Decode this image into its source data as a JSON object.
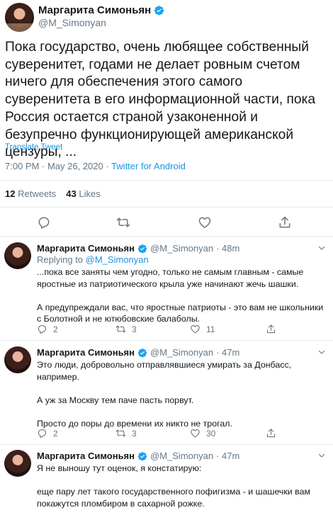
{
  "main": {
    "name": "Маргарита Симоньян",
    "handle": "@M_Simonyan",
    "text": "Пока государство, очень любящее собственный суверенитет, годами не делает ровным счетом ничего для обеспечения этого самого суверенитета в его информационной части, пока Россия остается страной узаконенной и безупречно функционирующей американской цензуры, ...",
    "translate_label": "Translate Tweet",
    "time": "7:00 PM · May 26, 2020 · ",
    "app": "Twitter for Android",
    "retweets_count": "12",
    "retweets_label": "Retweets",
    "likes_count": "43",
    "likes_label": "Likes"
  },
  "replies": [
    {
      "name": "Маргарита Симоньян",
      "handle": "@M_Simonyan",
      "time": "· 48m",
      "replying_label": "Replying to",
      "replying_to": "@M_Simonyan",
      "paragraphs": [
        "...пока все заняты чем угодно, только не самым главным - самые яростные из патриотического крыла уже начинают жечь шашки.",
        "А предупреждали вас, что яростные патриоты - это вам не школьники с  Болотной и не ютюбовские балаболы."
      ],
      "reply_count": "2",
      "retweet_count": "3",
      "like_count": "11"
    },
    {
      "name": "Маргарита Симоньян",
      "handle": "@M_Simonyan",
      "time": "· 47m",
      "paragraphs": [
        "Это люди, добровольно отправлявшиеся умирать за Донбасс, например.",
        "А уж за Москву тем паче пасть порвут.",
        "Просто до поры до времени их никто не трогал."
      ],
      "reply_count": "2",
      "retweet_count": "3",
      "like_count": "30"
    },
    {
      "name": "Маргарита Симоньян",
      "handle": "@M_Simonyan",
      "time": "· 47m",
      "paragraphs": [
        "Я не выношу тут оценок, я констатирую:",
        "еще пару лет такого государственного пофигизма - и шашечки вам покажутся пломбиром в сахарной рожке."
      ],
      "reply_count": "",
      "retweet_count": "",
      "like_count": ""
    }
  ],
  "colors": {
    "accent": "#1b95e0",
    "muted": "#657786",
    "text": "#14171a",
    "divider": "#e6ecf0"
  }
}
